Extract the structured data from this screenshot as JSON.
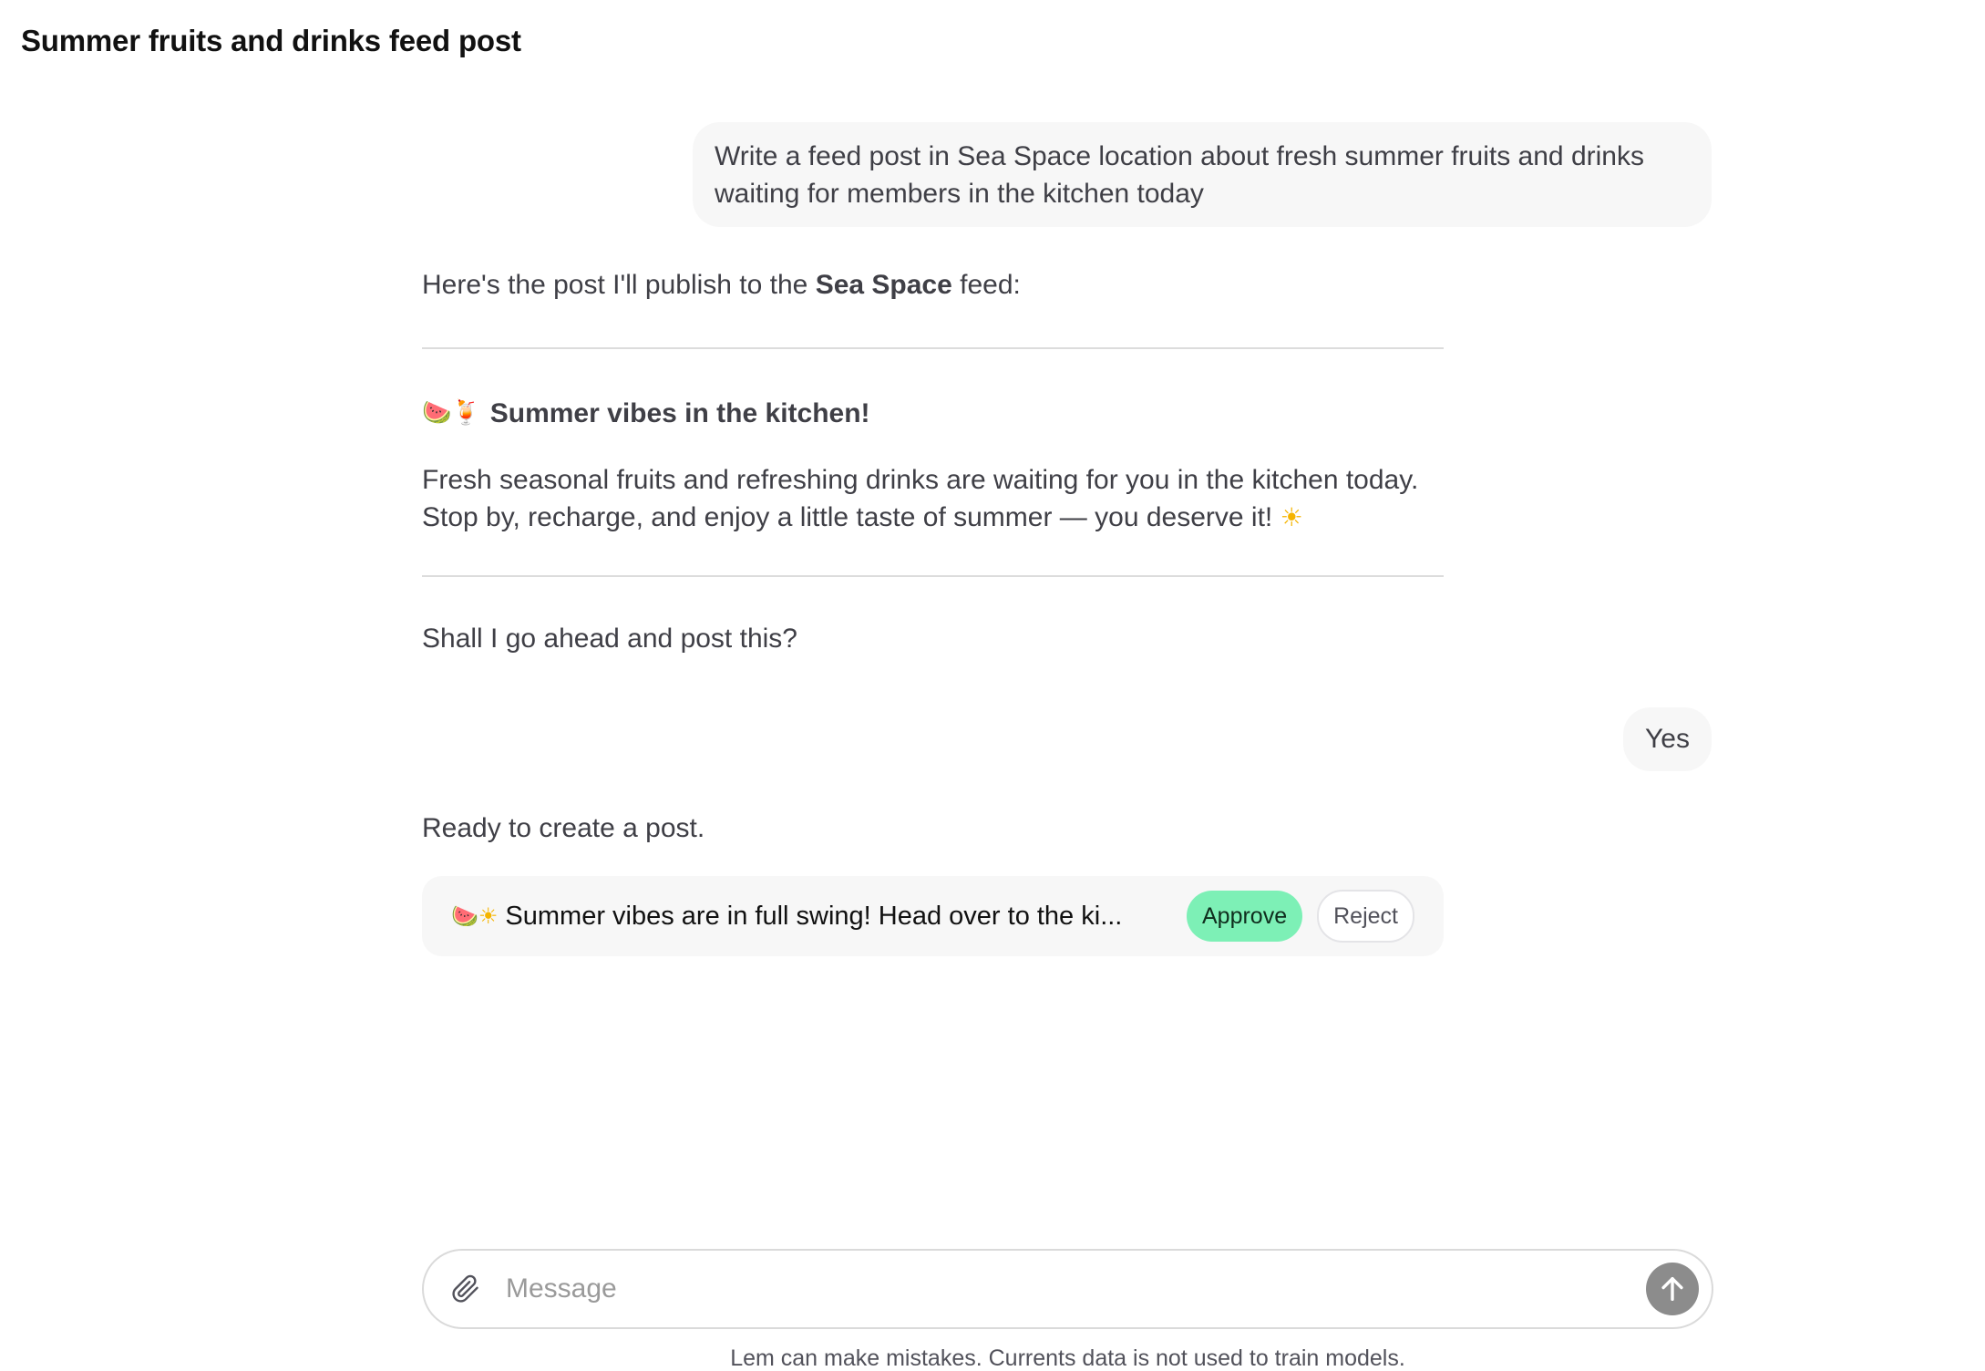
{
  "header": {
    "title": "Summer fruits and drinks feed post"
  },
  "conversation": {
    "user_prompt": "Write a feed post in Sea Space location about fresh summer fruits and drinks waiting for members in the kitchen today",
    "intro_prefix": "Here's the post I'll publish to the ",
    "intro_location": "Sea Space",
    "intro_suffix": " feed:",
    "post_emojis": "🍉🍹",
    "post_heading": "Summer vibes in the kitchen!",
    "post_body_line1": "Fresh seasonal fruits and refreshing drinks are waiting for you in the kitchen today.",
    "post_body_line2": "Stop by, recharge, and enjoy a little taste of summer — you deserve it!",
    "post_body_emoji": "☀",
    "confirm_question": "Shall I go ahead and post this?",
    "user_reply": "Yes",
    "ready_text": "Ready to create a post."
  },
  "action_card": {
    "emojis": "🍉☀",
    "preview": "Summer vibes are in full swing! Head over to the ki...",
    "approve_label": "Approve",
    "reject_label": "Reject"
  },
  "composer": {
    "placeholder": "Message",
    "attach_icon": "paperclip-icon",
    "send_icon": "arrow-up-icon"
  },
  "footer": {
    "disclaimer": "Lem can make mistakes. Currents data is not used to train models."
  },
  "colors": {
    "approve_bg": "#7df0b6",
    "bubble_bg": "#f7f7f7",
    "send_bg": "#8c8c8c"
  }
}
